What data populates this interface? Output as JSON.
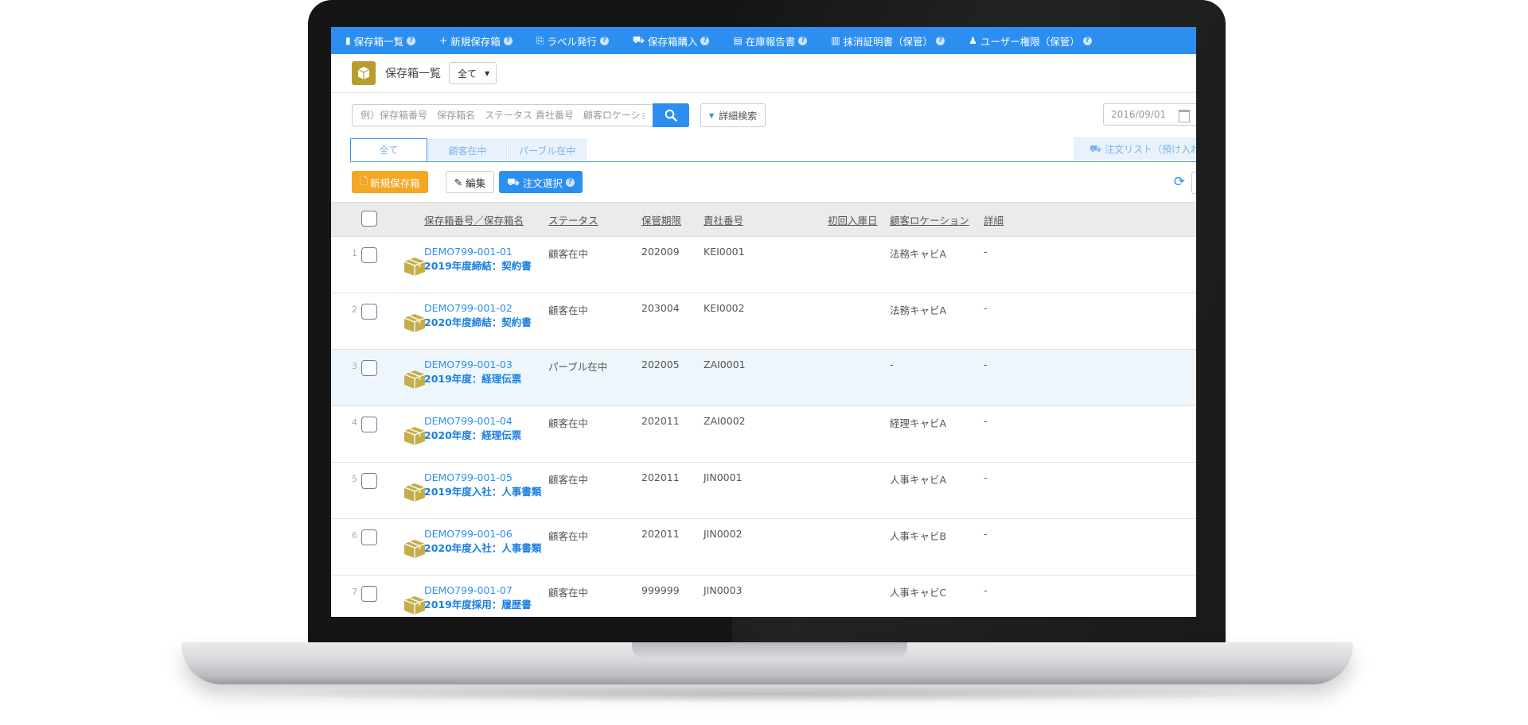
{
  "nav": [
    {
      "icon": "box-list-icon",
      "glyph": "▮",
      "label": "保存箱一覧",
      "help": "?"
    },
    {
      "icon": "plus-icon",
      "glyph": "+",
      "label": "新規保存箱",
      "help": "?"
    },
    {
      "icon": "label-icon",
      "glyph": "⎘",
      "label": "ラベル発行",
      "help": "?"
    },
    {
      "icon": "cart-icon",
      "glyph": "⛟",
      "label": "保存箱購入",
      "help": "?"
    },
    {
      "icon": "report-icon",
      "glyph": "▤",
      "label": "在庫報告書",
      "help": "?"
    },
    {
      "icon": "certificate-icon",
      "glyph": "▥",
      "label": "抹消証明書（保管）",
      "help": "?"
    },
    {
      "icon": "users-icon",
      "glyph": "♟",
      "label": "ユーザー権限（保管）",
      "help": "?"
    }
  ],
  "page": {
    "title": "保存箱一覧",
    "filter_value": "全て"
  },
  "search": {
    "placeholder": "例）保存箱番号　保存箱名　ステータス 責社番号　顧客ロケーション",
    "advanced_label": "詳細検索",
    "date_value": "2016/09/01"
  },
  "tabs": [
    "全て",
    "顧客在中",
    "パーブル在中"
  ],
  "order_tab_label": "注文リスト（預け入れ）",
  "toolbar": {
    "new_box": "新規保存箱",
    "edit": "編集",
    "order_select": "注文選択",
    "help": "?"
  },
  "table": {
    "headers": {
      "number_name": "保存箱番号／保存箱名",
      "status": "ステータス",
      "period": "保管期限",
      "company_no": "責社番号",
      "first_in": "初回入庫日",
      "location": "顧客ロケーション",
      "detail": "詳細"
    },
    "rows": [
      {
        "n": "1",
        "code": "DEMO799-001-01",
        "name": "2019年度締結：契約書",
        "status": "顧客在中",
        "period": "202009",
        "company_no": "KEI0001",
        "location": "法務キャビA",
        "detail": "-"
      },
      {
        "n": "2",
        "code": "DEMO799-001-02",
        "name": "2020年度締結：契約書",
        "status": "顧客在中",
        "period": "203004",
        "company_no": "KEI0002",
        "location": "法務キャビA",
        "detail": "-"
      },
      {
        "n": "3",
        "code": "DEMO799-001-03",
        "name": "2019年度：経理伝票",
        "status": "パーブル在中",
        "period": "202005",
        "company_no": "ZAI0001",
        "location": "-",
        "detail": "-"
      },
      {
        "n": "4",
        "code": "DEMO799-001-04",
        "name": "2020年度：経理伝票",
        "status": "顧客在中",
        "period": "202011",
        "company_no": "ZAI0002",
        "location": "経理キャビA",
        "detail": "-"
      },
      {
        "n": "5",
        "code": "DEMO799-001-05",
        "name": "2019年度入社：人事書類",
        "status": "顧客在中",
        "period": "202011",
        "company_no": "JIN0001",
        "location": "人事キャビA",
        "detail": "-"
      },
      {
        "n": "6",
        "code": "DEMO799-001-06",
        "name": "2020年度入社：人事書類",
        "status": "顧客在中",
        "period": "202011",
        "company_no": "JIN0002",
        "location": "人事キャビB",
        "detail": "-"
      },
      {
        "n": "7",
        "code": "DEMO799-001-07",
        "name": "2019年度採用：履歴書",
        "status": "顧客在中",
        "period": "999999",
        "company_no": "JIN0003",
        "location": "人事キャビC",
        "detail": "-"
      }
    ]
  },
  "colors": {
    "primary": "#2c8ff0",
    "accent_orange": "#f5a623",
    "box_gold": "#b89d2e",
    "row_highlight": "#eef6fc"
  }
}
